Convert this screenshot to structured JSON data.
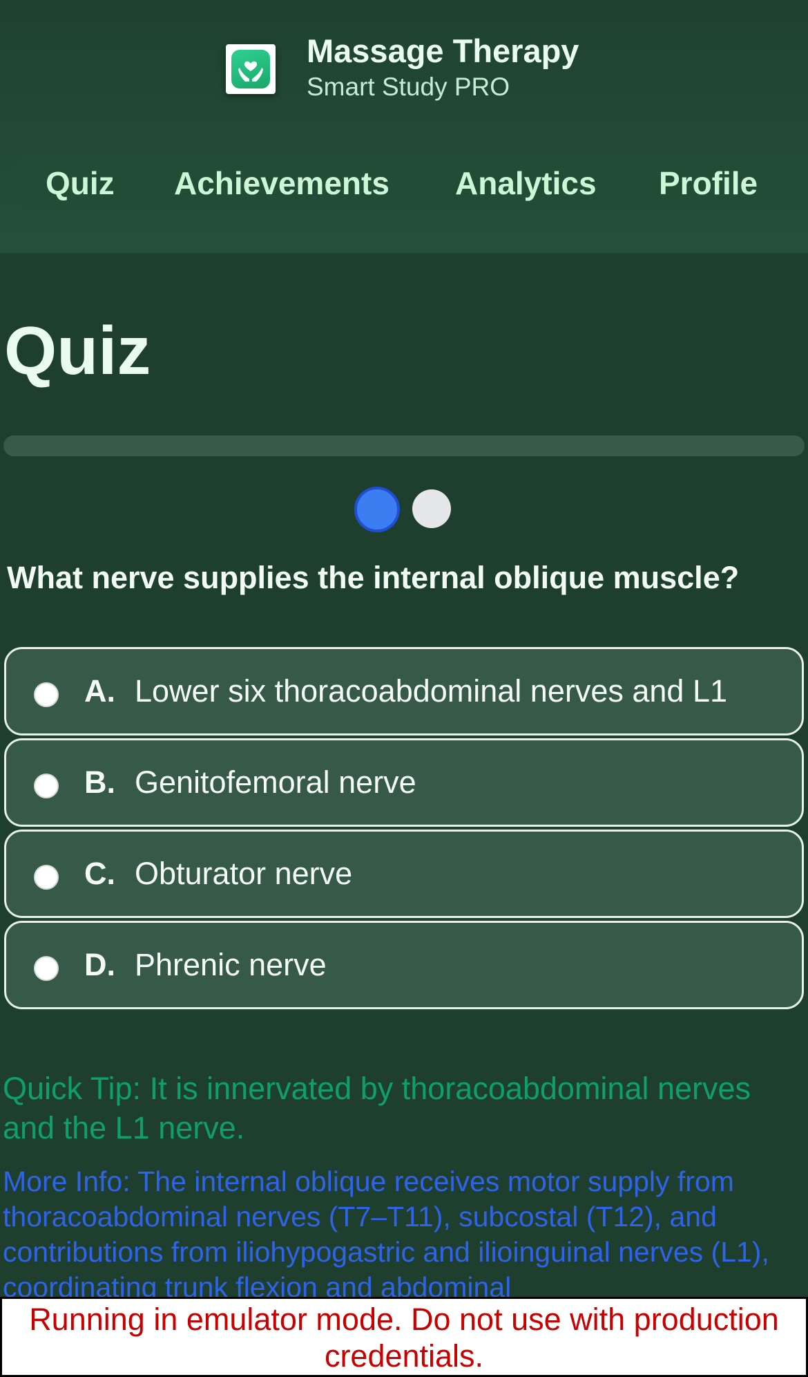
{
  "header": {
    "app_title": "Massage Therapy",
    "app_subtitle": "Smart Study PRO",
    "icon": "hands-heart-icon"
  },
  "nav": {
    "items": [
      {
        "label": "Quiz"
      },
      {
        "label": "Achievements"
      },
      {
        "label": "Analytics"
      },
      {
        "label": "Profile"
      }
    ]
  },
  "page": {
    "title": "Quiz",
    "progress_fraction": 0
  },
  "pager": {
    "current": 1,
    "total": 2
  },
  "question": {
    "text": "What nerve supplies the internal oblique muscle?",
    "options": [
      {
        "letter": "A.",
        "text": "Lower six thoracoabdominal nerves and L1"
      },
      {
        "letter": "B.",
        "text": "Genitofemoral nerve"
      },
      {
        "letter": "C.",
        "text": "Obturator nerve"
      },
      {
        "letter": "D.",
        "text": "Phrenic nerve"
      }
    ]
  },
  "tip": "Quick Tip: It is innervated by thoracoabdominal nerves and the L1 nerve.",
  "more_info": "More Info: The internal oblique receives motor supply from thoracoabdominal nerves (T7–T11), subcostal (T12), and contributions from iliohypogastric and ilioinguinal nerves (L1), coordinating trunk flexion and abdominal",
  "banner": "Running in emulator mode. Do not use with production credentials.",
  "colors": {
    "background": "#1e3f2d",
    "accent_blue": "#3d7df2",
    "tip_green": "#0f9f6c",
    "info_blue": "#2f63e8",
    "banner_red": "#c90000"
  }
}
